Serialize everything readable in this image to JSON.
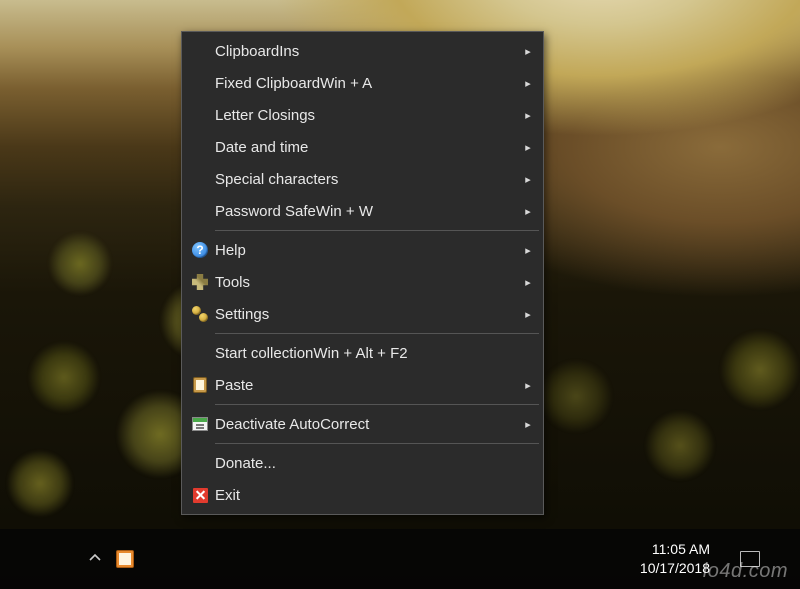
{
  "menu": {
    "groups": [
      [
        {
          "label": "Clipboard",
          "shortcut": "Ins",
          "submenu": true
        },
        {
          "label": "Fixed Clipboard",
          "shortcut": "Win + A",
          "submenu": true
        },
        {
          "label": "Letter Closings",
          "shortcut": "",
          "submenu": true
        },
        {
          "label": "Date and time",
          "shortcut": "",
          "submenu": true
        },
        {
          "label": "Special characters",
          "shortcut": "",
          "submenu": true
        },
        {
          "label": "Password Safe",
          "shortcut": "Win + W",
          "submenu": true
        }
      ],
      [
        {
          "icon": "help",
          "label": "Help",
          "shortcut": "",
          "submenu": true
        },
        {
          "icon": "tools",
          "label": "Tools",
          "shortcut": "",
          "submenu": true
        },
        {
          "icon": "settings",
          "label": "Settings",
          "shortcut": "",
          "submenu": true
        }
      ],
      [
        {
          "label": "Start collection",
          "shortcut": "Win + Alt + F2",
          "submenu": false
        },
        {
          "icon": "paste",
          "label": "Paste",
          "shortcut": "",
          "submenu": true
        }
      ],
      [
        {
          "icon": "autocorrect",
          "label": "Deactivate AutoCorrect",
          "shortcut": "",
          "submenu": true
        }
      ],
      [
        {
          "label": "Donate...",
          "shortcut": "",
          "submenu": false
        },
        {
          "icon": "exit",
          "label": "Exit",
          "shortcut": "",
          "submenu": false
        }
      ]
    ]
  },
  "taskbar": {
    "time": "11:05 AM",
    "date": "10/17/2018"
  },
  "watermark": "lo4d.com"
}
